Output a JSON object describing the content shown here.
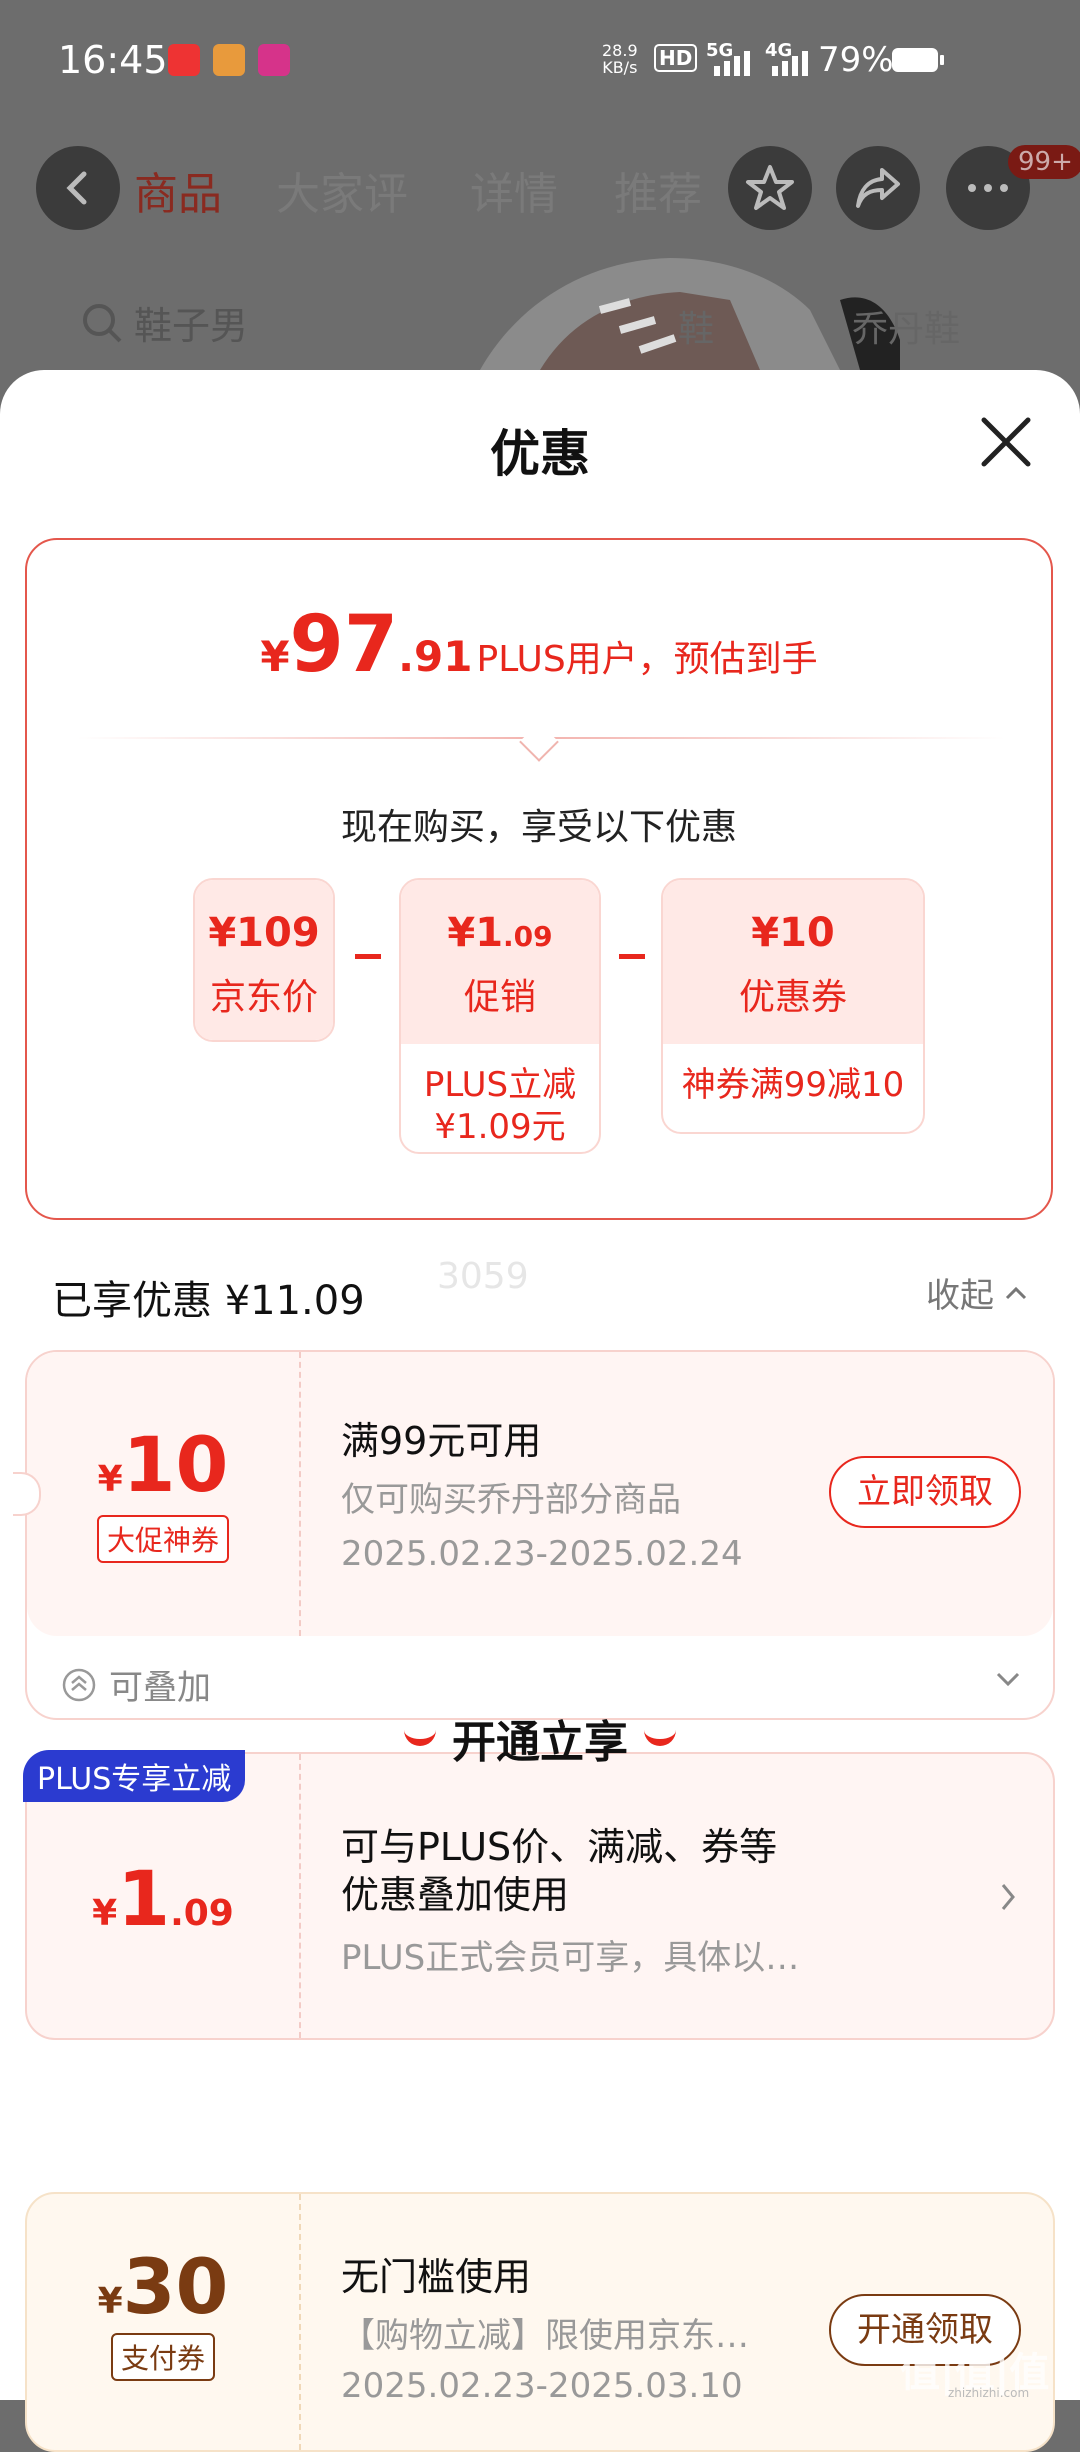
{
  "status_bar": {
    "time": "16:45",
    "net_speed": "28.9",
    "net_unit": "KB/s",
    "hd": "HD",
    "g5": "5G",
    "g4": "4G",
    "battery": "79%"
  },
  "bg_nav": {
    "tabs": [
      "商品",
      "大家评",
      "详情",
      "推荐"
    ],
    "badge": "99+",
    "search_text": "鞋子男",
    "chips": [
      "鞋",
      "乔丹鞋"
    ]
  },
  "sheet": {
    "title": "优惠"
  },
  "summary": {
    "currency": "¥",
    "price_int": "97",
    "price_dec": ".91",
    "price_label": "PLUS用户，预估到手",
    "buy_now": "现在购买，享受以下优惠",
    "breakdown": [
      {
        "amount": "¥109",
        "name": "京东价",
        "sub": ""
      },
      {
        "amount_int": "¥1",
        "amount_dec": ".09",
        "name": "促销",
        "sub": "PLUS立减\n¥1.09元"
      },
      {
        "amount": "¥10",
        "name": "优惠券",
        "sub": "神券满99减10"
      }
    ],
    "watermark": "3059"
  },
  "enjoyed": {
    "label": "已享优惠 ¥11.09",
    "collapse": "收起"
  },
  "coupons": [
    {
      "yen": "¥",
      "amount": "10",
      "tag": "大促神券",
      "title": "满99元可用",
      "desc": "仅可购买乔丹部分商品",
      "date": "2025.02.23-2025.02.24",
      "button": "立即领取",
      "footer": "可叠加"
    },
    {
      "label": "PLUS专享立减",
      "yen": "¥",
      "amount_int": "1",
      "amount_dec": ".09",
      "title_line1": "可与PLUS价、满减、券等",
      "title_line2": "优惠叠加使用",
      "desc": "PLUS正式会员可享，具体以…"
    }
  ],
  "open_section": {
    "title": "开通立享",
    "coupon": {
      "yen": "¥",
      "amount": "30",
      "tag": "支付券",
      "title": "无门槛使用",
      "desc": "【购物立减】限使用京东…",
      "date": "2025.02.23-2025.03.10",
      "button": "开通领取"
    }
  },
  "site_watermark": {
    "text": "值|值|值",
    "url": "zhizhizhi.com"
  },
  "colors": {
    "accent": "#e8271d",
    "plus_blue": "#2b3bd0",
    "coupon_bg": "#fff5f3"
  }
}
